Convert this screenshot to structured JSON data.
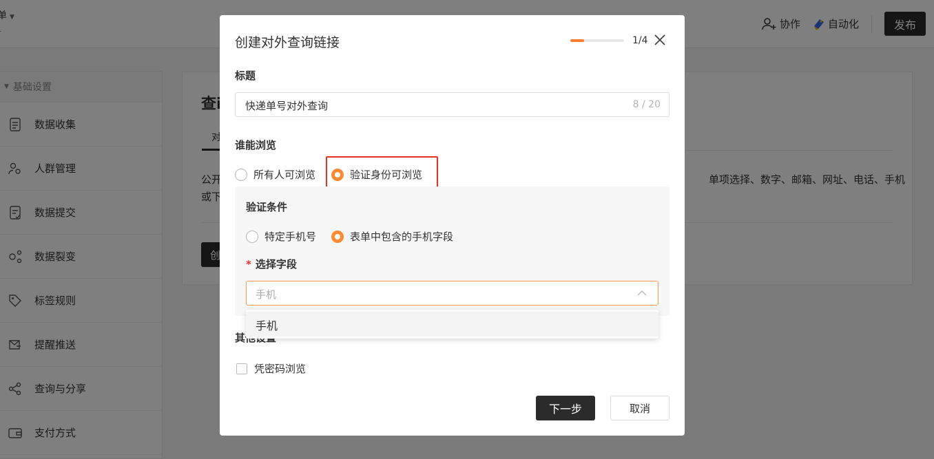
{
  "app": {
    "title_fragment": "单",
    "subtitle_fragment": "-",
    "collaborate_label": "协作",
    "automation_label": "自动化",
    "publish_label": "发布"
  },
  "sidebar": {
    "section_label": "基础设置",
    "items": [
      {
        "label": "数据收集",
        "icon": "document-icon"
      },
      {
        "label": "人群管理",
        "icon": "user-group-icon"
      },
      {
        "label": "数据提交",
        "icon": "submit-doc-icon"
      },
      {
        "label": "数据裂变",
        "icon": "fission-icon"
      },
      {
        "label": "标签规则",
        "icon": "tag-icon"
      },
      {
        "label": "提醒推送",
        "icon": "notification-icon"
      },
      {
        "label": "查询与分享",
        "icon": "share-icon"
      },
      {
        "label": "支付方式",
        "icon": "wallet-icon"
      }
    ]
  },
  "content": {
    "title_fragment": "查i",
    "tab_fragment": "对",
    "desc_left_fragment": "公开\n或下",
    "desc_right_fragment": "单项选择、数字、邮箱、网址、电话、手机",
    "button_fragment": "创"
  },
  "modal": {
    "title": "创建对外查询链接",
    "step_current": 1,
    "step_total": 4,
    "step_label": "1/4",
    "progress_fraction": 0.25,
    "title_label": "标题",
    "title_value": "快递单号对外查询",
    "title_counter": "8 / 20",
    "browse_label": "谁能浏览",
    "browse_options": [
      "所有人可浏览",
      "验证身份可浏览"
    ],
    "browse_selected": "验证身份可浏览",
    "verify_label": "验证条件",
    "verify_options": [
      "特定手机号",
      "表单中包含的手机字段"
    ],
    "verify_selected": "表单中包含的手机字段",
    "field_required_mark": "*",
    "field_label": "选择字段",
    "field_placeholder": "手机",
    "dropdown_options": [
      "手机"
    ],
    "other_label": "其他设置",
    "password_label": "凭密码浏览",
    "next_label": "下一步",
    "cancel_label": "取消"
  },
  "colors": {
    "accent": "#ff8a33",
    "highlight_border": "#e5302a",
    "dark_button": "#2b2b2b"
  }
}
